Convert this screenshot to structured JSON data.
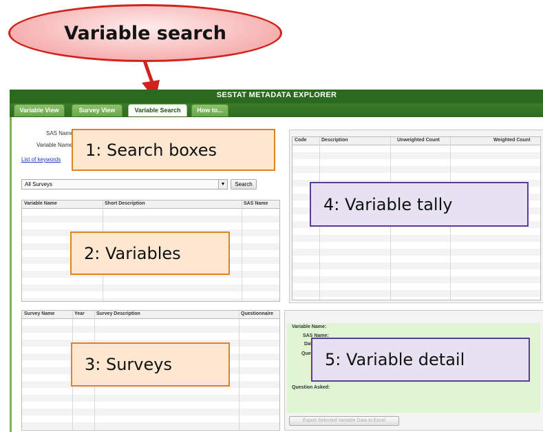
{
  "callout": {
    "title": "Variable search"
  },
  "app": {
    "title": "SESTAT METADATA EXPLORER",
    "tabs": [
      {
        "label": "Variable View"
      },
      {
        "label": "Survey View"
      },
      {
        "label": "Variable Search",
        "active": true
      },
      {
        "label": "How to..."
      }
    ]
  },
  "search": {
    "sas_name_label": "SAS Name",
    "variable_name_label": "Variable Name",
    "keywords_link": "List of keywords",
    "survey_select": "All Surveys",
    "search_button": "Search"
  },
  "variables_grid": {
    "columns": [
      "Variable Name",
      "Short Description",
      "SAS Name"
    ]
  },
  "surveys_grid": {
    "columns": [
      "Survey Name",
      "Year",
      "Survey Description",
      "Questionnaire"
    ]
  },
  "tally_grid": {
    "columns": [
      "Code",
      "Description",
      "Unweighted Count",
      "Weighted Count"
    ]
  },
  "detail": {
    "variable_name": "Variable Name:",
    "sas_name": "SAS Name:",
    "dat": "Dat",
    "ques": "Ques",
    "question_asked": "Question Asked:",
    "export_button": "Export Selected Variable Data to Excel"
  },
  "overlays": {
    "search_boxes": "1:  Search boxes",
    "variables": "2:  Variables",
    "surveys": "3:  Surveys",
    "variable_tally": "4:  Variable tally",
    "variable_detail": "5:  Variable detail"
  },
  "colors": {
    "callout_red": "#d0231e",
    "app_green": "#2b6a1e",
    "overlay_orange": "#e3801f",
    "overlay_purple": "#5a3d93"
  }
}
